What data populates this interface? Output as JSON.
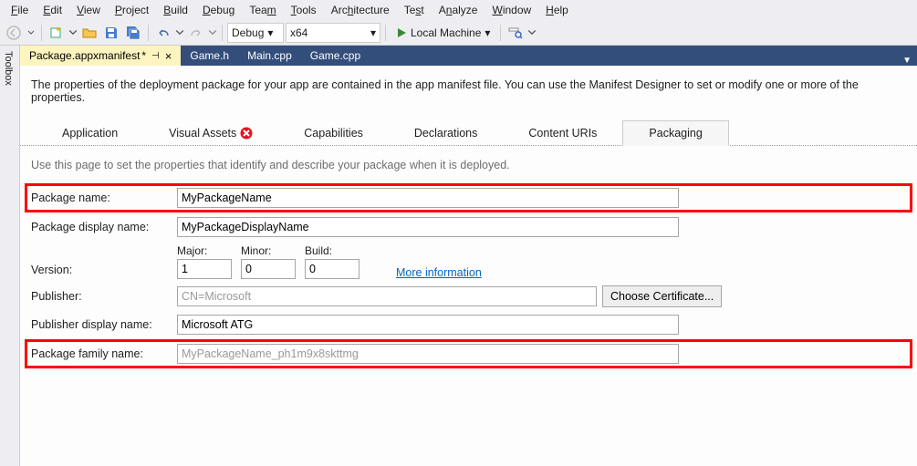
{
  "menu": {
    "file": "File",
    "edit": "Edit",
    "view": "View",
    "project": "Project",
    "build": "Build",
    "debug": "Debug",
    "team": "Team",
    "tools": "Tools",
    "architecture": "Architecture",
    "test": "Test",
    "analyze": "Analyze",
    "window": "Window",
    "help": "Help"
  },
  "toolbar": {
    "config": "Debug",
    "platform": "x64",
    "run": "Local Machine"
  },
  "sidebar": {
    "toolbox": "Toolbox"
  },
  "tabs": [
    {
      "label": "Package.appxmanifest",
      "modified": "*",
      "active": true
    },
    {
      "label": "Game.h"
    },
    {
      "label": "Main.cpp"
    },
    {
      "label": "Game.cpp"
    }
  ],
  "page": {
    "desc": "The properties of the deployment package for your app are contained in the app manifest file. You can use the Manifest Designer to set or modify one or more of the properties.",
    "nav": {
      "application": "Application",
      "visual_assets": "Visual Assets",
      "capabilities": "Capabilities",
      "declarations": "Declarations",
      "content_uris": "Content URIs",
      "packaging": "Packaging"
    },
    "hint": "Use this page to set the properties that identify and describe your package when it is deployed.",
    "labels": {
      "package_name": "Package name:",
      "package_display_name": "Package display name:",
      "version": "Version:",
      "major": "Major:",
      "minor": "Minor:",
      "build": "Build:",
      "more_info": "More information",
      "publisher": "Publisher:",
      "choose_cert": "Choose Certificate...",
      "publisher_display_name": "Publisher display name:",
      "package_family_name": "Package family name:"
    },
    "values": {
      "package_name": "MyPackageName",
      "package_display_name": "MyPackageDisplayName",
      "major": "1",
      "minor": "0",
      "build": "0",
      "publisher": "CN=Microsoft",
      "publisher_display_name": "Microsoft ATG",
      "package_family_name": "MyPackageName_ph1m9x8skttmg"
    }
  }
}
